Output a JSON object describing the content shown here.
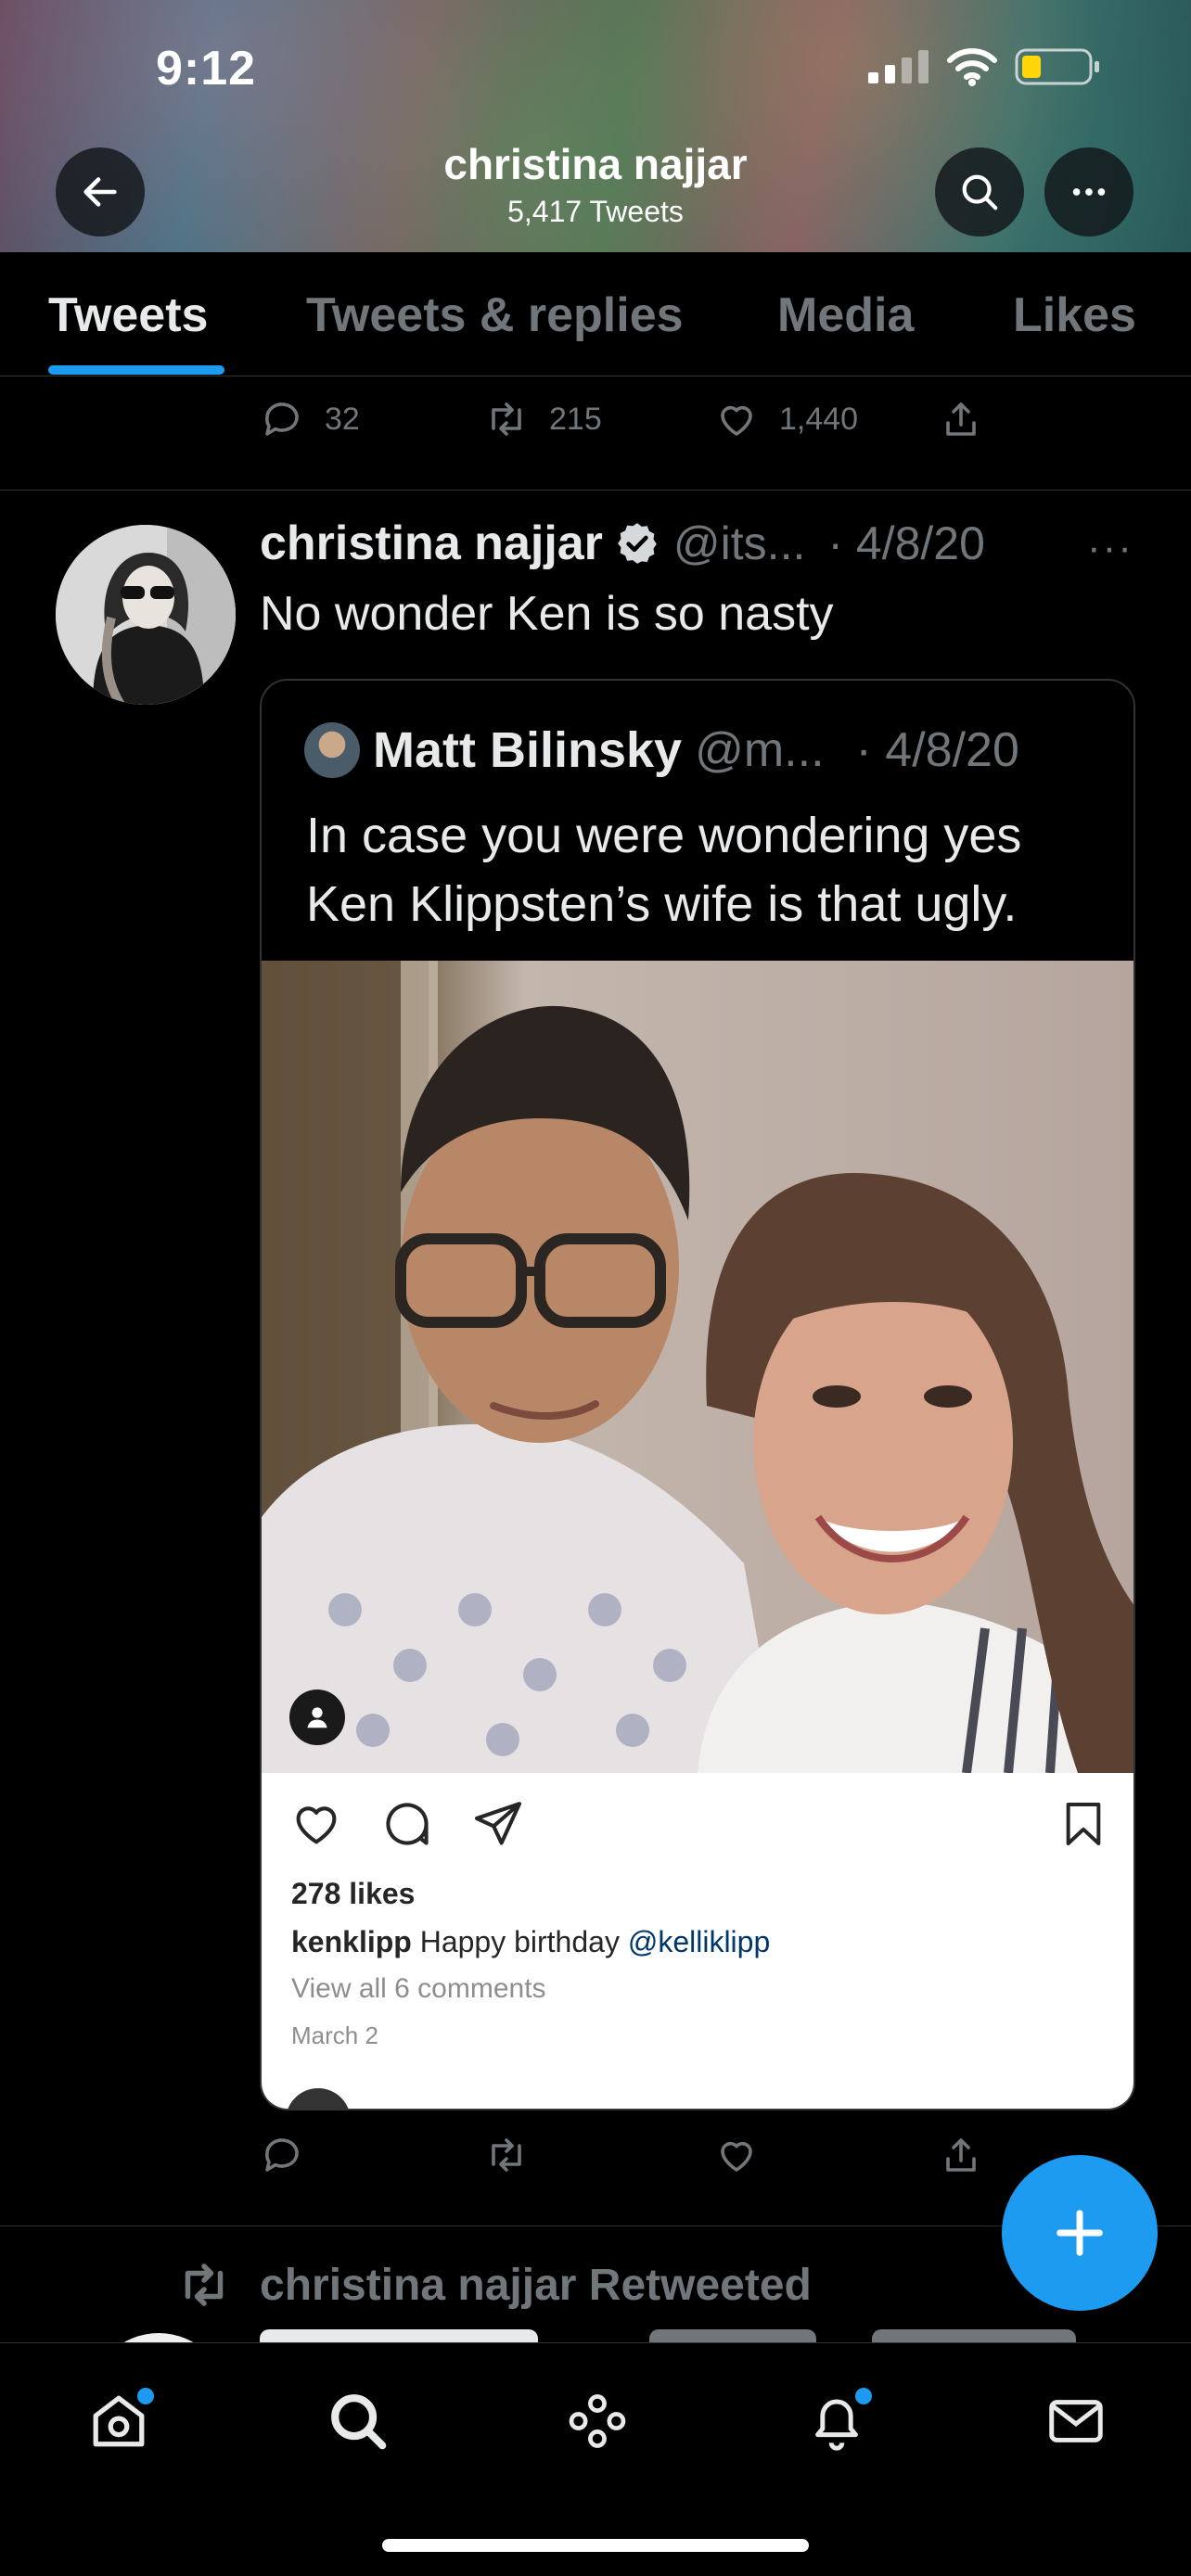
{
  "status_bar": {
    "time": "9:12"
  },
  "profile_header": {
    "name": "christina najjar",
    "tweet_count": "5,417 Tweets"
  },
  "tabs": [
    {
      "label": "Tweets",
      "active": true
    },
    {
      "label": "Tweets & replies",
      "active": false
    },
    {
      "label": "Media",
      "active": false
    },
    {
      "label": "Likes",
      "active": false
    }
  ],
  "previous_tweet_actions": {
    "replies": "32",
    "retweets": "215",
    "likes": "1,440"
  },
  "tweet": {
    "display_name": "christina najjar",
    "handle": "@its...",
    "date": "· 4/8/20",
    "more": "···",
    "text": "No wonder Ken is so nasty",
    "quoted": {
      "display_name": "Matt Bilinsky",
      "handle": "@m...",
      "date": "· 4/8/20",
      "text": "In case you were wondering yes Ken Klippsten’s wife is that ugly.",
      "instagram": {
        "likes": "278 likes",
        "username": "kenklipp",
        "caption": "Happy birthday",
        "mention": "@kelliklipp",
        "view_comments": "View all 6 comments",
        "date": "March 2"
      }
    }
  },
  "retweeted_label": "christina najjar Retweeted",
  "colors": {
    "accent": "#1d9bf0",
    "background": "#000000",
    "muted": "#71767b",
    "text": "#e7e9ea"
  },
  "icons": {
    "nav": [
      "home-icon",
      "search-icon",
      "spaces-icon",
      "notifications-icon",
      "messages-icon"
    ],
    "compose": "plus-icon"
  }
}
